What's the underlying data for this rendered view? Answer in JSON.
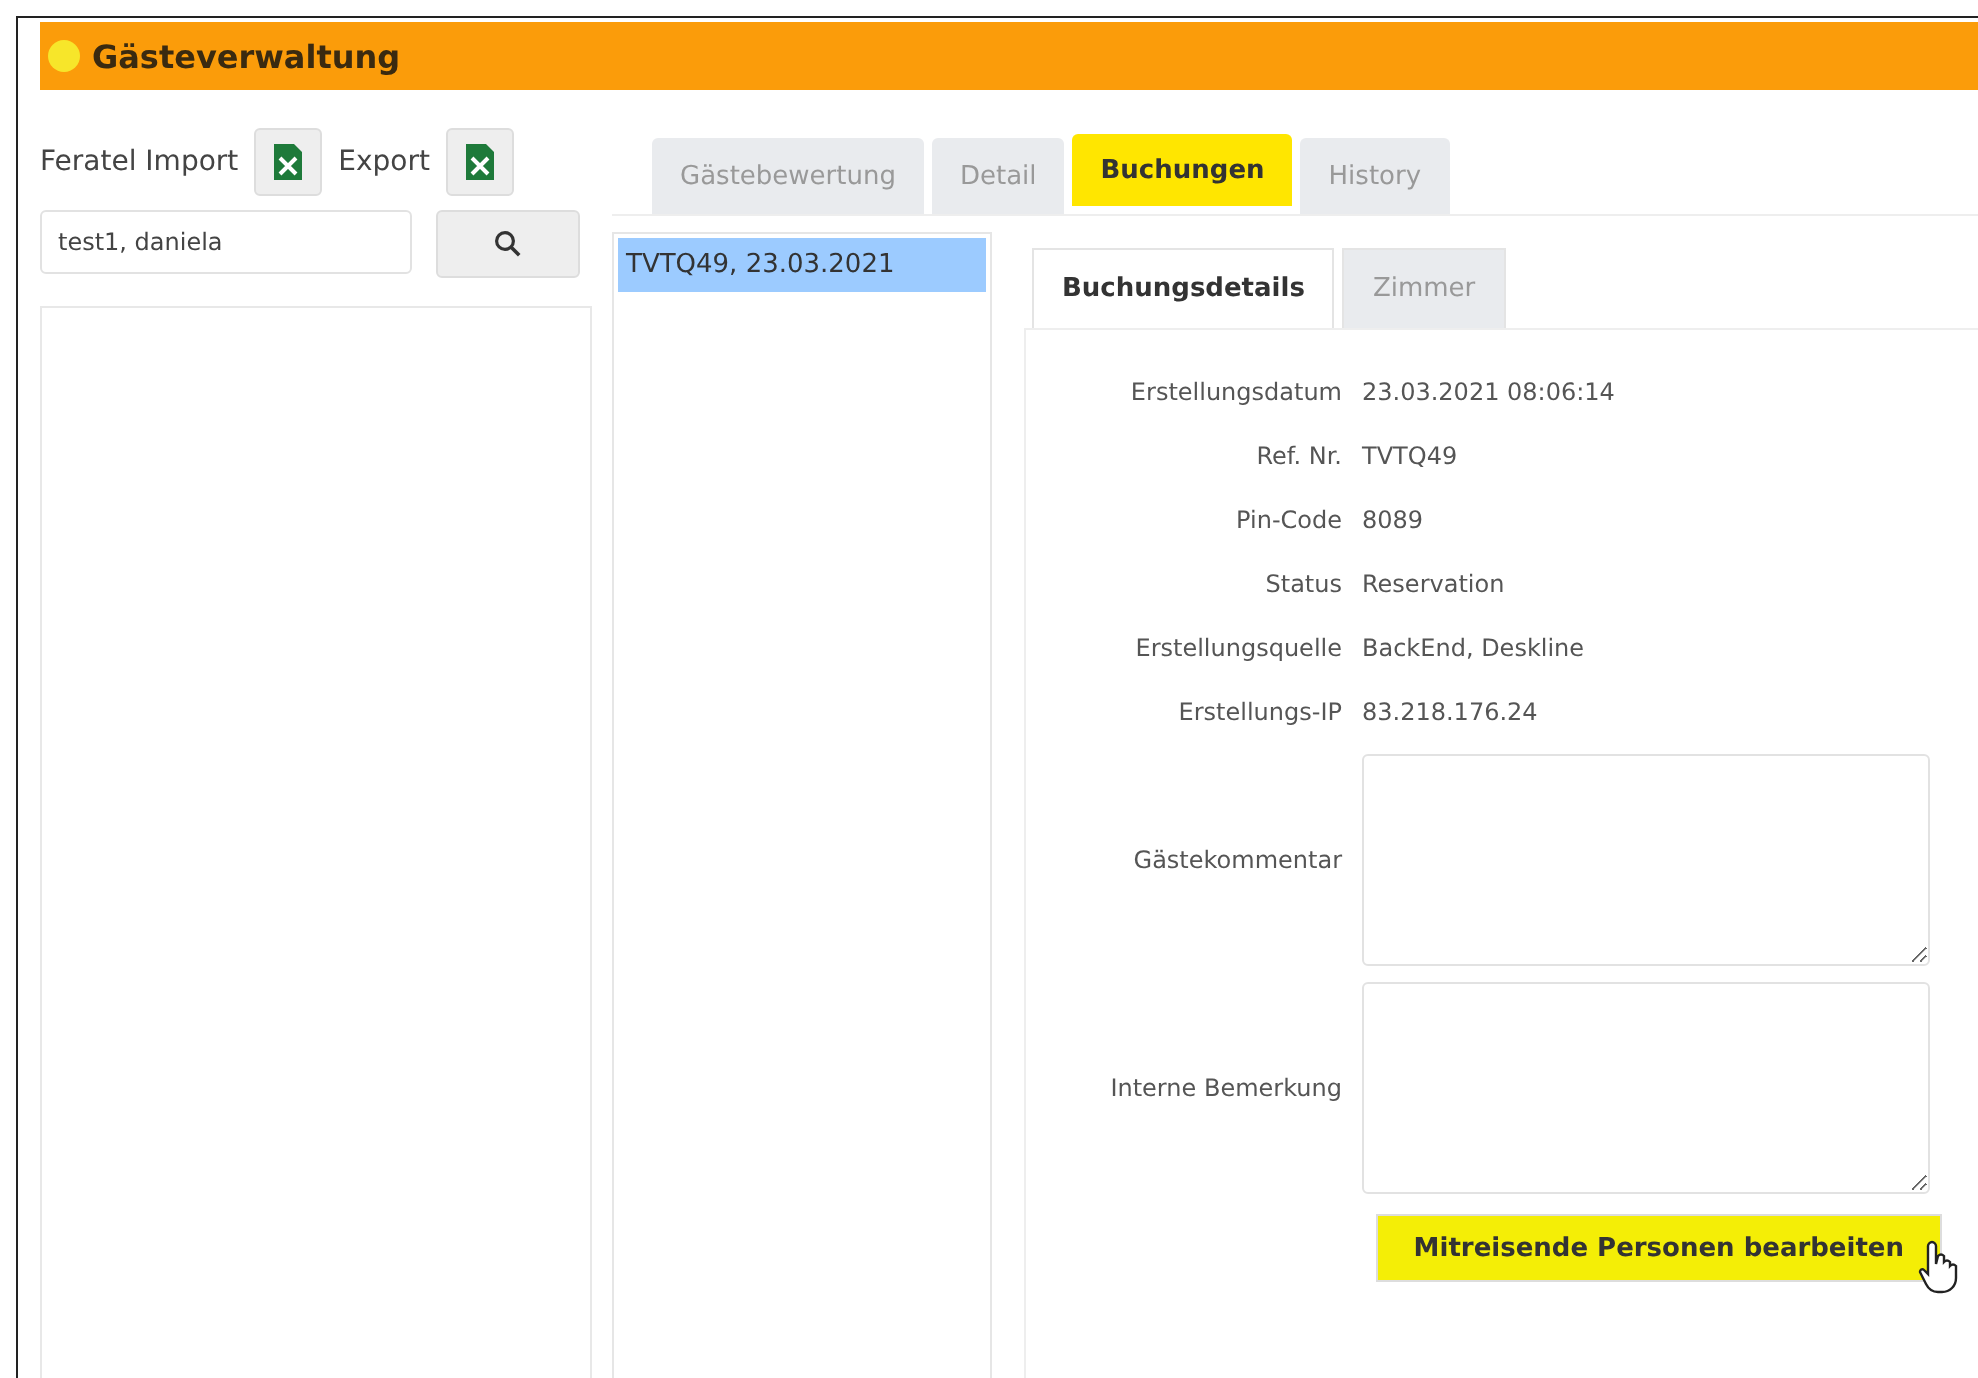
{
  "window": {
    "title": "Gästeverwaltung"
  },
  "toolbar": {
    "import_label": "Feratel Import",
    "export_label": "Export"
  },
  "search": {
    "value": "test1, daniela"
  },
  "tabs": [
    {
      "label": "Gästebewertung",
      "selected": false
    },
    {
      "label": "Detail",
      "selected": false
    },
    {
      "label": "Buchungen",
      "selected": true
    },
    {
      "label": "History",
      "selected": false
    }
  ],
  "bookings": [
    {
      "label": "TVTQ49, 23.03.2021",
      "selected": true
    }
  ],
  "subtabs": [
    {
      "label": "Buchungsdetails",
      "selected": true
    },
    {
      "label": "Zimmer",
      "selected": false
    }
  ],
  "details": [
    {
      "label": "Erstellungsdatum",
      "value": "23.03.2021 08:06:14"
    },
    {
      "label": "Ref. Nr.",
      "value": "TVTQ49"
    },
    {
      "label": "Pin-Code",
      "value": "8089"
    },
    {
      "label": "Status",
      "value": "Reservation"
    },
    {
      "label": "Erstellungsquelle",
      "value": "BackEnd, Deskline"
    },
    {
      "label": "Erstellungs-IP",
      "value": "83.218.176.24"
    }
  ],
  "comments": [
    {
      "label": "Gästekommentar"
    },
    {
      "label": "Interne Bemerkung"
    }
  ],
  "action_button": {
    "label": "Mitreisende Personen bearbeiten",
    "highlighted": true
  }
}
